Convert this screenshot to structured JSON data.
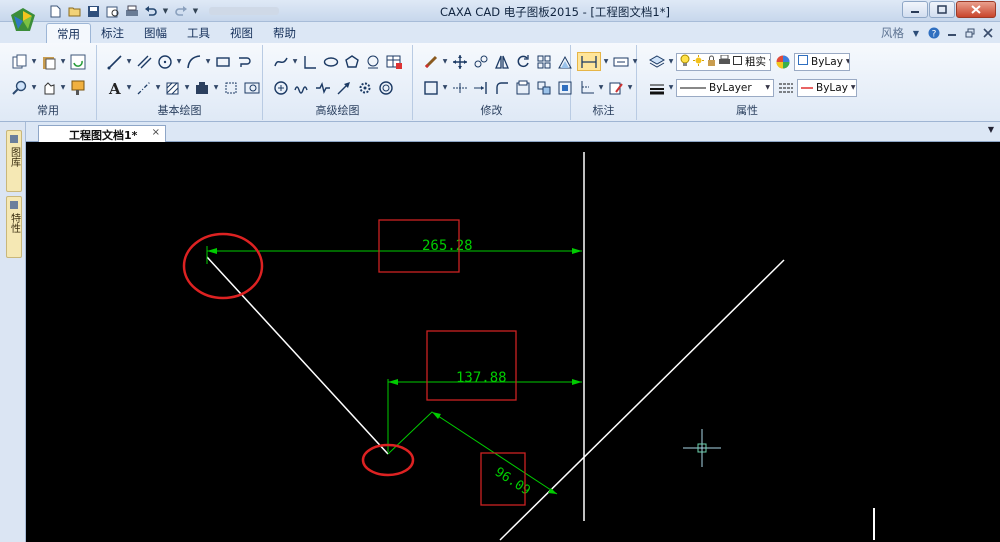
{
  "window": {
    "title": "CAXA CAD 电子图板2015 - [工程图文档1*]",
    "quick_access_icons": [
      "new-icon",
      "open-icon",
      "save-icon",
      "print-preview-icon",
      "print-icon",
      "undo-icon",
      "redo-icon"
    ]
  },
  "ribbon_tabs": [
    {
      "label": "常用",
      "active": true
    },
    {
      "label": "标注",
      "active": false
    },
    {
      "label": "图幅",
      "active": false
    },
    {
      "label": "工具",
      "active": false
    },
    {
      "label": "视图",
      "active": false
    },
    {
      "label": "帮助",
      "active": false
    }
  ],
  "style_label": "风格",
  "groups": {
    "common": "常用",
    "basic_draw": "基本绘图",
    "advanced_draw": "高级绘图",
    "modify": "修改",
    "annotation": "标注",
    "properties": "属性"
  },
  "properties": {
    "linewidth_value": "粗实",
    "color_value": "ByLay",
    "linetype_value": "ByLayer",
    "linecolor_value": "ByLay"
  },
  "side_panels": [
    "图库",
    "特性"
  ],
  "document_tab": {
    "label": "工程图文档1*",
    "close": "×"
  },
  "drawing": {
    "dimensions": [
      "265.28",
      "137.88",
      "96.09"
    ],
    "line_color": "#ffffff",
    "dimension_color": "#00cc00",
    "highlight_box_color": "#cc2222",
    "highlight_circle_color": "#dd2222"
  }
}
